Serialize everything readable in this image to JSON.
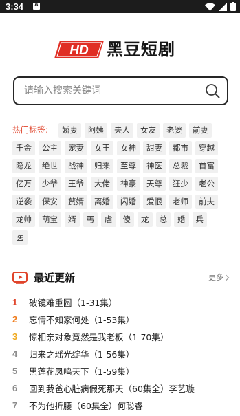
{
  "status_bar": {
    "time": "3:34",
    "notification_icon": "a-icon",
    "wifi_icon": "wifi-icon",
    "signal_icon": "signal-icon",
    "battery_icon": "battery-icon"
  },
  "logo": {
    "badge_text": "HD",
    "title": "黑豆短剧",
    "brand_color": "#e02e24"
  },
  "search": {
    "placeholder": "请输入搜索关键词",
    "icon": "search-icon"
  },
  "hot_tags": {
    "label": "热门标签:",
    "label_color": "#e0442b",
    "rows": [
      [
        "娇妻",
        "阿姨",
        "夫人",
        "女友",
        "老婆",
        "前妻"
      ],
      [
        "千金",
        "公主",
        "宠妻",
        "女王",
        "女神",
        "甜妻",
        "都市",
        "穿越"
      ],
      [
        "隐龙",
        "绝世",
        "战神",
        "归来",
        "至尊",
        "神医",
        "总裁",
        "首富"
      ],
      [
        "亿万",
        "少爷",
        "王爷",
        "大佬",
        "神豪",
        "天尊",
        "狂少",
        "老公"
      ],
      [
        "逆袭",
        "保安",
        "赘婿",
        "离婚",
        "闪婚",
        "爱恨",
        "老师",
        "前夫"
      ],
      [
        "龙帅",
        "萌宝",
        "婿",
        "丐",
        "虐",
        "傻",
        "龙",
        "总",
        "婚",
        "兵"
      ],
      [
        "医"
      ]
    ]
  },
  "recent": {
    "title": "最近更新",
    "icon": "tv-play-icon",
    "more_label": "更多",
    "items": [
      {
        "rank": "1",
        "title": "破镜难重圆（1-31集）"
      },
      {
        "rank": "2",
        "title": "忘情不知家何处（1-53集）"
      },
      {
        "rank": "3",
        "title": "惊相亲对象竟然是我老板（1-70集）"
      },
      {
        "rank": "4",
        "title": "归来之瑶光绽华（1-56集）"
      },
      {
        "rank": "5",
        "title": "黑莲花凤鸣天下（1-59集）"
      },
      {
        "rank": "6",
        "title": "回到我爸心脏病假死那天（60集全）李艺璇"
      },
      {
        "rank": "7",
        "title": "不为他折腰（60集全）何聪睿"
      }
    ]
  }
}
